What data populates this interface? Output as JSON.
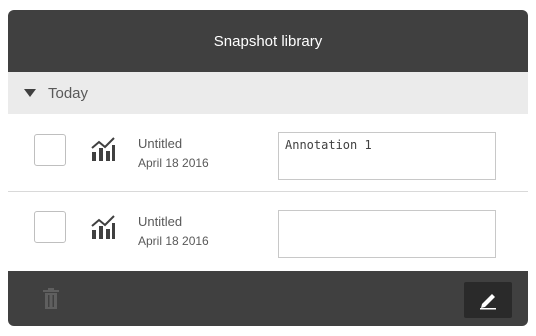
{
  "dialog": {
    "title": "Snapshot library"
  },
  "group": {
    "label": "Today",
    "expanded": true
  },
  "snapshots": [
    {
      "title": "Untitled",
      "date": "April 18 2016",
      "annotation": "Annotation 1",
      "checked": false
    },
    {
      "title": "Untitled",
      "date": "April 18 2016",
      "annotation": "",
      "checked": false
    }
  ],
  "footer": {
    "delete_icon": "trash-icon",
    "edit_icon": "pencil-icon",
    "delete_enabled": false
  },
  "colors": {
    "header_bg": "#404040",
    "group_bg": "#ebebeb",
    "text": "#595959",
    "edit_button_bg": "#2a2a2a"
  }
}
